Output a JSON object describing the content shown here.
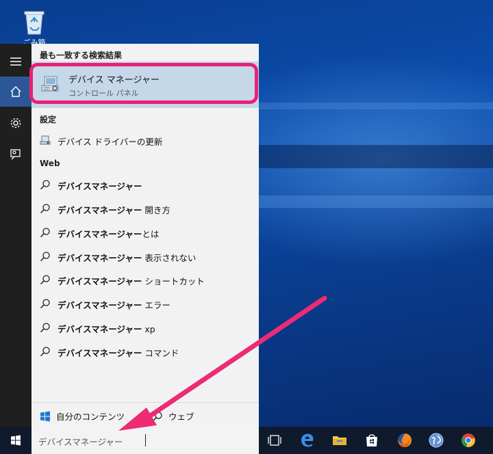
{
  "desktop": {
    "recycle_bin_label": "ごみ箱"
  },
  "start_rail": {
    "items": [
      "menu-icon",
      "home-icon",
      "settings-icon",
      "feedback-icon"
    ]
  },
  "search_panel": {
    "best_match_header": "最も一致する検索結果",
    "best_match": {
      "title": "デバイス マネージャー",
      "subtitle": "コントロール パネル"
    },
    "settings_header": "設定",
    "settings_items": [
      {
        "label": "デバイス ドライバーの更新"
      }
    ],
    "web_header": "Web",
    "web_items": [
      {
        "bold": "デバイスマネージャー",
        "rest": ""
      },
      {
        "bold": "デバイスマネージャー",
        "rest": " 開き方"
      },
      {
        "bold": "デバイスマネージャー",
        "rest": "とは"
      },
      {
        "bold": "デバイスマネージャー",
        "rest": " 表示されない"
      },
      {
        "bold": "デバイスマネージャー",
        "rest": " ショートカット"
      },
      {
        "bold": "デバイスマネージャー",
        "rest": " エラー"
      },
      {
        "bold": "デバイスマネージャー",
        "rest": " xp"
      },
      {
        "bold": "デバイスマネージャー",
        "rest": " コマンド"
      }
    ],
    "filters": {
      "my_content": "自分のコンテンツ",
      "web": "ウェブ"
    }
  },
  "taskbar": {
    "search_value": "デバイスマネージャー",
    "pinned": [
      "task-view-icon",
      "edge-icon",
      "file-explorer-icon",
      "store-icon",
      "firefox-icon",
      "globe-browser-icon",
      "chrome-icon"
    ]
  },
  "colors": {
    "accent": "#2b5797",
    "highlight": "#ec1f72",
    "selected_bg": "#c4d8ea"
  }
}
